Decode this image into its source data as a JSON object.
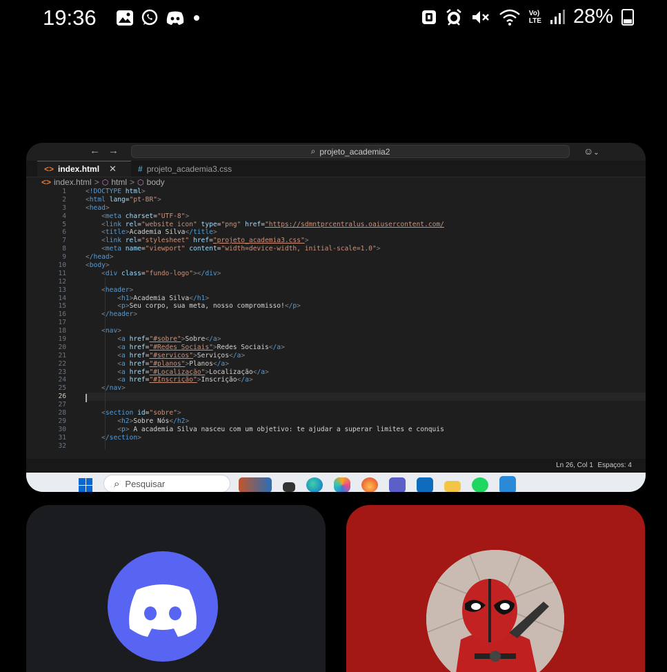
{
  "status_bar": {
    "time": "19:36",
    "battery": "28%",
    "volte_top": "Vo)",
    "volte_bottom": "LTE"
  },
  "screen_share": {
    "titlebar": {
      "search_text": "projeto_academia2"
    },
    "tabs": [
      {
        "label": "index.html",
        "active": true
      },
      {
        "label": "projeto_academia3.css",
        "active": false
      }
    ],
    "breadcrumb": [
      "index.html",
      "html",
      "body"
    ],
    "editor": {
      "line_numbers": [
        "1",
        "2",
        "3",
        "4",
        "5",
        "6",
        "7",
        "8",
        "9",
        "10",
        "11",
        "12",
        "13",
        "14",
        "15",
        "16",
        "17",
        "18",
        "19",
        "20",
        "21",
        "22",
        "23",
        "24",
        "25",
        "26",
        "27",
        "28",
        "29",
        "30",
        "31",
        "32"
      ],
      "current_line": 26,
      "lines": [
        "<!DOCTYPE html>",
        "<html lang=\"pt-BR\">",
        "<head>",
        "    <meta charset=\"UTF-8\">",
        "    <link rel=\"website icon\" type=\"png\" href=\"https://sdmntprcentralus.oaiusercontent.com/",
        "    <title>Academia Silva</title>",
        "    <link rel=\"stylesheet\" href=\"projeto_academia3.css\">",
        "    <meta name=\"viewport\" content=\"width=device-width, initial-scale=1.0\">",
        "</head>",
        "<body>",
        "    <div class=\"fundo-logo\"></div>",
        "",
        "    <header>",
        "        <h1>Academia Silva</h1>",
        "        <p>Seu corpo, sua meta, nosso compromisso!</p>",
        "    </header>",
        "",
        "    <nav>",
        "        <a href=\"#sobre\">Sobre</a>",
        "        <a href=\"#Redes Sociais\">Redes Sociais</a>",
        "        <a href=\"#servicos\">Serviços</a>",
        "        <a href=\"#planos\">Planos</a>",
        "        <a href=\"#Localização\">Localização</a>",
        "        <a href=\"#Inscrição\">Inscrição</a>",
        "    </nav>",
        "",
        "",
        "    <section id=\"sobre\">",
        "        <h2>Sobre Nós</h2>",
        "        <p> A academia Silva nasceu com um objetivo: te ajudar a superar limites e conquis",
        "    </section>",
        ""
      ]
    },
    "status": {
      "position": "Ln 26, Col 1",
      "spaces": "Espaços: 4"
    },
    "taskbar": {
      "search_placeholder": "Pesquisar"
    }
  },
  "participants": [
    {
      "id": "discord",
      "tile_color": "#1b1c1f",
      "icon": "discord-logo-icon",
      "icon_color": "#5865f2"
    },
    {
      "id": "user",
      "tile_color": "#a31814",
      "icon": "deadpool-avatar"
    }
  ],
  "colors": {
    "editor_bg": "#1e1e1e",
    "keyword_tag": "#569cd6",
    "attribute": "#9cdcfe",
    "string": "#ce9178"
  }
}
